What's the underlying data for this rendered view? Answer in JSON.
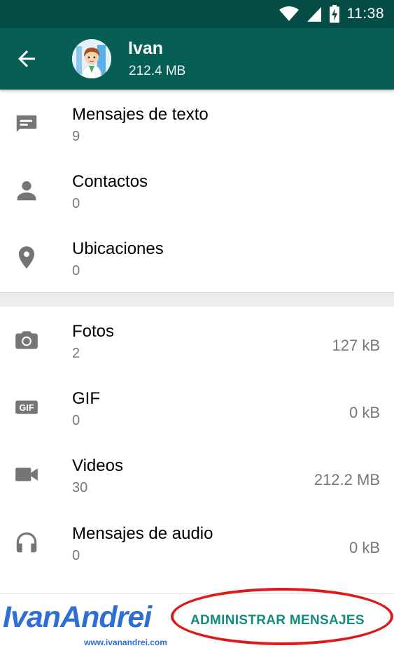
{
  "status_bar": {
    "time": "11:38",
    "icons": [
      "wifi-icon",
      "signal-icon",
      "battery-charging-icon"
    ]
  },
  "header": {
    "contact_name": "Ivan",
    "storage_size": "212.4 MB",
    "icons": [
      "back-arrow-icon",
      "avatar"
    ]
  },
  "message_types": [
    {
      "title": "Mensajes de texto",
      "count": "9",
      "icon": "message-icon"
    },
    {
      "title": "Contactos",
      "count": "0",
      "icon": "person-icon"
    },
    {
      "title": "Ubicaciones",
      "count": "0",
      "icon": "location-pin-icon"
    }
  ],
  "media_types": [
    {
      "title": "Fotos",
      "count": "2",
      "size": "127 kB",
      "icon": "camera-icon"
    },
    {
      "title": "GIF",
      "count": "0",
      "size": "0 kB",
      "icon": "gif-icon",
      "icon_text": "GIF"
    },
    {
      "title": "Videos",
      "count": "30",
      "size": "212.2 MB",
      "icon": "videocam-icon"
    },
    {
      "title": "Mensajes de audio",
      "count": "0",
      "size": "0 kB",
      "icon": "headphones-icon"
    }
  ],
  "footer": {
    "action_label": "ADMINISTRAR MENSAJES"
  },
  "watermark": {
    "logo_text": "IvanAndrei",
    "url": "www.ivanandrei.com"
  },
  "colors": {
    "status_bar": "#054d44",
    "app_bar": "#075e54",
    "accent": "#128c7e",
    "annotation_circle": "#e01818",
    "watermark": "#2f6fd4"
  }
}
